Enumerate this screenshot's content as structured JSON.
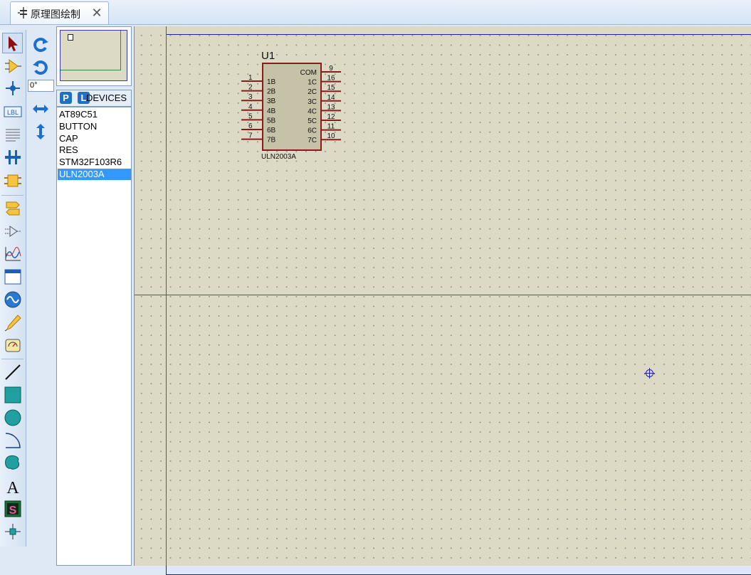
{
  "tab": {
    "title": "原理图绘制",
    "close": "✕"
  },
  "toolbar": {
    "items": [
      {
        "name": "selection-mode",
        "icon": "arrow-cursor-icon"
      },
      {
        "name": "component-mode",
        "icon": "component-icon"
      },
      {
        "name": "junction-mode",
        "icon": "junction-dot-icon"
      },
      {
        "name": "wire-label-mode",
        "icon": "label-icon",
        "text": "LBL"
      },
      {
        "name": "text-script-mode",
        "icon": "text-script-icon"
      },
      {
        "name": "bus-mode",
        "icon": "bus-icon"
      },
      {
        "name": "subcircuit-mode",
        "icon": "subcircuit-icon"
      },
      {
        "name": "terminals-mode",
        "icon": "terminal-icon"
      },
      {
        "name": "device-pins-mode",
        "icon": "pin-icon"
      },
      {
        "name": "graph-mode",
        "icon": "graph-icon"
      },
      {
        "name": "tape-recorder-mode",
        "icon": "window-icon"
      },
      {
        "name": "generator-mode",
        "icon": "generator-icon"
      },
      {
        "name": "voltage-probe-mode",
        "icon": "probe-icon"
      },
      {
        "name": "virtual-instruments-mode",
        "icon": "instrument-icon"
      },
      {
        "name": "2d-line-mode",
        "icon": "line-icon"
      },
      {
        "name": "2d-box-mode",
        "icon": "box-icon"
      },
      {
        "name": "2d-circle-mode",
        "icon": "circle-icon"
      },
      {
        "name": "2d-arc-mode",
        "icon": "arc-icon"
      },
      {
        "name": "2d-path-mode",
        "icon": "path-icon"
      },
      {
        "name": "2d-text-mode",
        "icon": "text-icon",
        "text": "A"
      },
      {
        "name": "2d-symbol-mode",
        "icon": "symbol-icon",
        "text": "S"
      },
      {
        "name": "2d-marker-mode",
        "icon": "marker-icon"
      }
    ]
  },
  "rotation": {
    "angle": "0°"
  },
  "devices": {
    "p_button": "P",
    "l_button": "L",
    "label": "DEVICES",
    "items": [
      "AT89C51",
      "BUTTON",
      "CAP",
      "RES",
      "STM32F103R6",
      "ULN2003A"
    ],
    "selected": "ULN2003A"
  },
  "component": {
    "ref": "U1",
    "part": "ULN2003A",
    "left_pins": [
      {
        "num": "1",
        "name": "1B"
      },
      {
        "num": "2",
        "name": "2B"
      },
      {
        "num": "3",
        "name": "3B"
      },
      {
        "num": "4",
        "name": "4B"
      },
      {
        "num": "5",
        "name": "5B"
      },
      {
        "num": "6",
        "name": "6B"
      },
      {
        "num": "7",
        "name": "7B"
      }
    ],
    "right_pins": [
      {
        "num": "9",
        "name": "COM"
      },
      {
        "num": "16",
        "name": "1C"
      },
      {
        "num": "15",
        "name": "2C"
      },
      {
        "num": "14",
        "name": "3C"
      },
      {
        "num": "13",
        "name": "4C"
      },
      {
        "num": "12",
        "name": "5C"
      },
      {
        "num": "11",
        "name": "6C"
      },
      {
        "num": "10",
        "name": "7C"
      }
    ]
  },
  "colors": {
    "accent": "#3399ff",
    "component_outline": "#8b1a1a",
    "canvas": "#dcdac5",
    "sheet_border": "#2020a8"
  }
}
